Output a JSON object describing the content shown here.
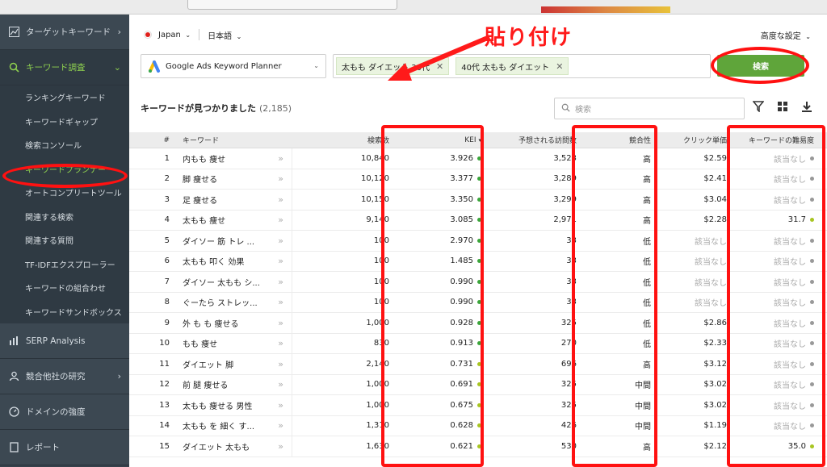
{
  "sidebar": {
    "sections": [
      {
        "label": "ターゲットキーワード",
        "icon": "chart-icon",
        "chevron": "›"
      },
      {
        "label": "キーワード調査",
        "icon": "search-icon",
        "chevron": "⌄"
      }
    ],
    "items": [
      {
        "label": "ランキングキーワード"
      },
      {
        "label": "キーワードギャップ"
      },
      {
        "label": "検索コンソール"
      },
      {
        "label": "キーワードプランナー"
      },
      {
        "label": "オートコンプリートツール"
      },
      {
        "label": "関連する検索"
      },
      {
        "label": "関連する質問"
      },
      {
        "label": "TF-IDFエクスプローラー"
      },
      {
        "label": "キーワードの組合わせ"
      },
      {
        "label": "キーワードサンドボックス"
      }
    ],
    "lower_sections": [
      {
        "label": "SERP Analysis",
        "icon": "bar-chart-icon",
        "chevron": ""
      },
      {
        "label": "競合他社の研究",
        "icon": "person-icon",
        "chevron": "›"
      },
      {
        "label": "ドメインの強度",
        "icon": "gauge-icon",
        "chevron": ""
      },
      {
        "label": "レポート",
        "icon": "report-icon",
        "chevron": ""
      }
    ]
  },
  "toolbar": {
    "country": "Japan",
    "language": "日本語",
    "advanced": "高度な設定",
    "database": "Google Ads Keyword Planner",
    "tags": [
      "太もも ダイエット 30代",
      "40代 太もも ダイエット"
    ],
    "search_button": "検索",
    "callout": "貼り付け"
  },
  "results": {
    "title": "キーワードが見つかりました",
    "count": "(2,185)",
    "search_placeholder": "検索"
  },
  "table": {
    "headers": {
      "num": "#",
      "keyword": "キーワード",
      "volume": "検索数",
      "kei": "KEI",
      "visits": "予想される訪問数",
      "competition": "競合性",
      "cpc": "クリック単価",
      "difficulty": "キーワードの難易度"
    },
    "rows": [
      {
        "num": "1",
        "keyword": "内もも 痩せ",
        "volume": "10,840",
        "kei": "3.926",
        "kei_color": "#3ba53b",
        "visits": "3,523",
        "competition": "高",
        "cpc": "$2.59",
        "difficulty": "該当なし",
        "diff_color": "#999999"
      },
      {
        "num": "2",
        "keyword": "脚 痩せる",
        "volume": "10,120",
        "kei": "3.377",
        "kei_color": "#3ba53b",
        "visits": "3,289",
        "competition": "高",
        "cpc": "$2.41",
        "difficulty": "該当なし",
        "diff_color": "#999999"
      },
      {
        "num": "3",
        "keyword": "足 痩せる",
        "volume": "10,150",
        "kei": "3.350",
        "kei_color": "#3ba53b",
        "visits": "3,299",
        "competition": "高",
        "cpc": "$3.04",
        "difficulty": "該当なし",
        "diff_color": "#999999"
      },
      {
        "num": "4",
        "keyword": "太もも 痩せ",
        "volume": "9,140",
        "kei": "3.085",
        "kei_color": "#3ba53b",
        "visits": "2,971",
        "competition": "高",
        "cpc": "$2.28",
        "difficulty": "31.7",
        "diff_color": "#a8c522"
      },
      {
        "num": "5",
        "keyword": "ダイソー 筋 トレ ...",
        "volume": "100",
        "kei": "2.970",
        "kei_color": "#3ba53b",
        "visits": "33",
        "competition": "低",
        "cpc": "該当なし",
        "difficulty": "該当なし",
        "diff_color": "#999999"
      },
      {
        "num": "6",
        "keyword": "太もも 叩く 効果",
        "volume": "100",
        "kei": "1.485",
        "kei_color": "#3ba53b",
        "visits": "33",
        "competition": "低",
        "cpc": "該当なし",
        "difficulty": "該当なし",
        "diff_color": "#999999"
      },
      {
        "num": "7",
        "keyword": "ダイソー 太もも シ...",
        "volume": "100",
        "kei": "0.990",
        "kei_color": "#3ba53b",
        "visits": "33",
        "competition": "低",
        "cpc": "該当なし",
        "difficulty": "該当なし",
        "diff_color": "#999999"
      },
      {
        "num": "8",
        "keyword": "ぐーたら ストレッ...",
        "volume": "100",
        "kei": "0.990",
        "kei_color": "#3ba53b",
        "visits": "33",
        "competition": "低",
        "cpc": "該当なし",
        "difficulty": "該当なし",
        "diff_color": "#999999"
      },
      {
        "num": "9",
        "keyword": "外 も も 痩せる",
        "volume": "1,000",
        "kei": "0.928",
        "kei_color": "#3ba53b",
        "visits": "325",
        "competition": "低",
        "cpc": "$2.86",
        "difficulty": "該当なし",
        "diff_color": "#999999"
      },
      {
        "num": "10",
        "keyword": "もも 痩せ",
        "volume": "830",
        "kei": "0.913",
        "kei_color": "#3ba53b",
        "visits": "270",
        "competition": "低",
        "cpc": "$2.33",
        "difficulty": "該当なし",
        "diff_color": "#999999"
      },
      {
        "num": "11",
        "keyword": "ダイエット 脚",
        "volume": "2,140",
        "kei": "0.731",
        "kei_color": "#a8c522",
        "visits": "696",
        "competition": "高",
        "cpc": "$3.12",
        "difficulty": "該当なし",
        "diff_color": "#999999"
      },
      {
        "num": "12",
        "keyword": "前 腿 痩せる",
        "volume": "1,000",
        "kei": "0.691",
        "kei_color": "#a8c522",
        "visits": "325",
        "competition": "中間",
        "cpc": "$3.02",
        "difficulty": "該当なし",
        "diff_color": "#999999"
      },
      {
        "num": "13",
        "keyword": "太もも 痩せる 男性",
        "volume": "1,000",
        "kei": "0.675",
        "kei_color": "#a8c522",
        "visits": "325",
        "competition": "中間",
        "cpc": "$3.02",
        "difficulty": "該当なし",
        "diff_color": "#999999"
      },
      {
        "num": "14",
        "keyword": "太もも を 細く す...",
        "volume": "1,310",
        "kei": "0.628",
        "kei_color": "#a8c522",
        "visits": "426",
        "competition": "中間",
        "cpc": "$1.19",
        "difficulty": "該当なし",
        "diff_color": "#999999"
      },
      {
        "num": "15",
        "keyword": "ダイエット 太もも",
        "volume": "1,630",
        "kei": "0.621",
        "kei_color": "#a8c522",
        "visits": "530",
        "competition": "高",
        "cpc": "$2.12",
        "difficulty": "35.0",
        "diff_color": "#a8c522"
      }
    ]
  }
}
